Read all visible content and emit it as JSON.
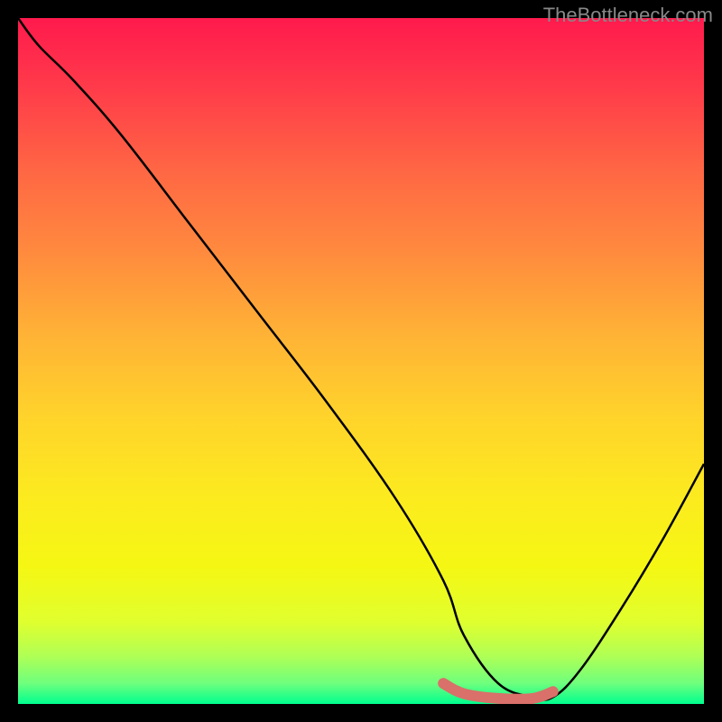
{
  "watermark": "TheBottleneck.com",
  "chart_data": {
    "type": "line",
    "title": "",
    "xlabel": "",
    "ylabel": "",
    "xlim": [
      0,
      100
    ],
    "ylim": [
      0,
      100
    ],
    "description": "Bottleneck percentage curve over a gradient from red (high) to green (low). The curve starts near 100 at x≈0, descends steeply and almost linearly to ≈0 near x≈65, remains near 0 (with a small highlighted plateau) until x≈78, then rises again toward ≈35 at x=100.",
    "series": [
      {
        "name": "bottleneck-curve",
        "x": [
          0,
          3,
          8,
          15,
          25,
          35,
          45,
          55,
          62,
          65,
          70,
          75,
          78,
          82,
          88,
          94,
          100
        ],
        "values": [
          100,
          96,
          91,
          83,
          70,
          57,
          44,
          30,
          18,
          10,
          3,
          1,
          1,
          5,
          14,
          24,
          35
        ]
      }
    ],
    "highlight_segment": {
      "name": "optimal-range",
      "x": [
        62,
        65,
        70,
        75,
        78
      ],
      "values": [
        3,
        1.5,
        0.8,
        0.8,
        1.8
      ],
      "color": "#d9706a"
    },
    "gradient_stops": [
      {
        "pos": 0.0,
        "color": "#ff1a4d"
      },
      {
        "pos": 0.5,
        "color": "#ffc030"
      },
      {
        "pos": 0.8,
        "color": "#f5f713"
      },
      {
        "pos": 1.0,
        "color": "#00ff8f"
      }
    ]
  }
}
